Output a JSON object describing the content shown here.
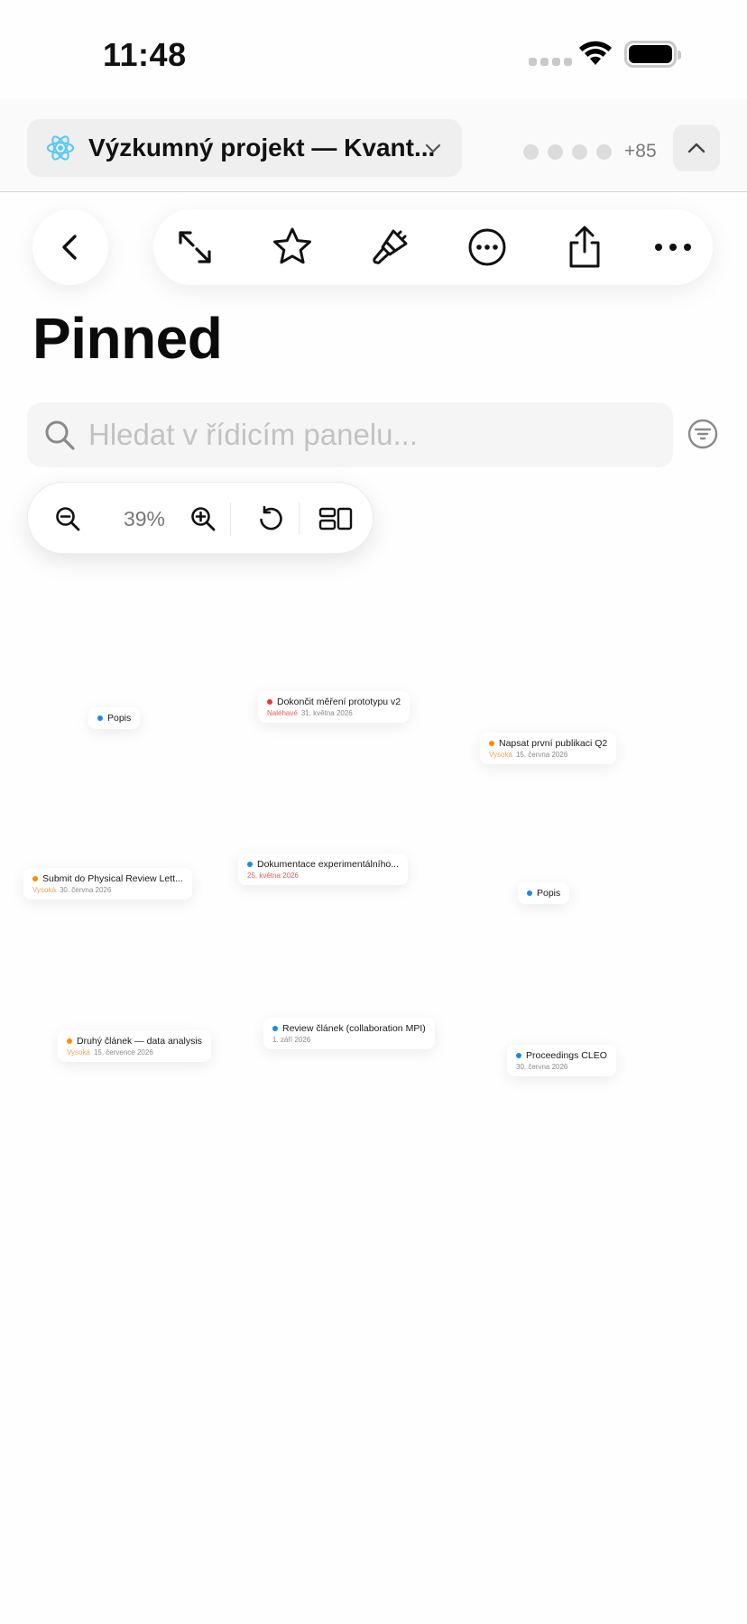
{
  "status_bar": {
    "time": "11:48"
  },
  "header": {
    "project_title": "Výzkumný projekt — Kvant...",
    "project_icon": "atom-icon",
    "collaborators_more": "+85"
  },
  "page": {
    "title": "Pinned"
  },
  "search": {
    "placeholder": "Hledat v řídicím panelu..."
  },
  "zoom": {
    "value": "39%"
  },
  "colors": {
    "blue": "#1e88e5",
    "red": "#e53935",
    "orange": "#fb8c00",
    "priority_orange": "#f5a25a",
    "priority_red": "#e55b5b"
  },
  "canvas_cards": [
    {
      "title": "Popis",
      "dot": "blue",
      "priority": "",
      "date": "",
      "date_color": ""
    },
    {
      "title": "Dokončit měření prototypu v2",
      "dot": "red",
      "priority": "Naléhavé",
      "date": "31. května 2026",
      "date_color": ""
    },
    {
      "title": "Napsat první publikaci Q2",
      "dot": "orange",
      "priority": "Vysoká",
      "date": "15. června 2026",
      "date_color": ""
    },
    {
      "title": "Submit do Physical Review Lett...",
      "dot": "orange",
      "priority": "Vysoká",
      "date": "30. června 2026",
      "date_color": ""
    },
    {
      "title": "Dokumentace experimentálního...",
      "dot": "blue",
      "priority": "",
      "date": "25. května 2026",
      "date_color": "red"
    },
    {
      "title": "Popis",
      "dot": "blue",
      "priority": "",
      "date": "",
      "date_color": ""
    },
    {
      "title": "Druhý článek — data analysis",
      "dot": "orange",
      "priority": "Vysoká",
      "date": "15. července 2026",
      "date_color": ""
    },
    {
      "title": "Review článek (collaboration MPI)",
      "dot": "blue",
      "priority": "",
      "date": "1. září 2026",
      "date_color": ""
    },
    {
      "title": "Proceedings CLEO",
      "dot": "blue",
      "priority": "",
      "date": "30. června 2026",
      "date_color": ""
    }
  ]
}
